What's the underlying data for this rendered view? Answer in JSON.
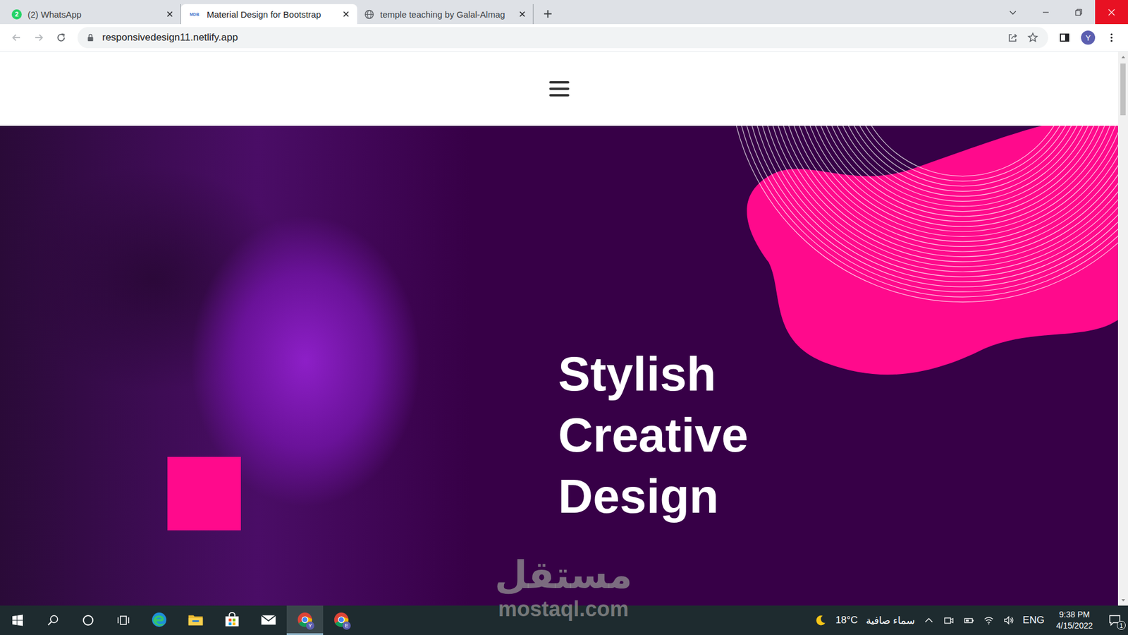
{
  "browser": {
    "tabs": [
      {
        "label": "(2) WhatsApp",
        "badge": "2",
        "kind": "whatsapp",
        "selected": false
      },
      {
        "label": "Material Design for Bootstrap",
        "badge": "MDB",
        "kind": "mdb",
        "selected": true
      },
      {
        "label": "temple teaching by Galal-Almag",
        "badge": "",
        "kind": "globe",
        "selected": false
      }
    ],
    "address": "responsivedesign11.netlify.app",
    "profile": "Y"
  },
  "page": {
    "hero": {
      "heading": [
        "Stylish",
        "Creative",
        "Design"
      ]
    }
  },
  "watermark": {
    "arabic": "مستقل",
    "latin": "mostaql.com"
  },
  "taskbar": {
    "apps": [
      {
        "kind": "edge",
        "badge": "",
        "active": false
      },
      {
        "kind": "explorer",
        "badge": "",
        "active": false
      },
      {
        "kind": "store",
        "badge": "",
        "active": false
      },
      {
        "kind": "mail",
        "badge": "",
        "active": false
      },
      {
        "kind": "chrome",
        "badge": "Y",
        "active": true
      },
      {
        "kind": "chrome",
        "badge": "E",
        "active": false
      }
    ],
    "weather": {
      "temp": "18°C",
      "condition": "سماء صافية"
    },
    "language": "ENG",
    "time": "9:38 PM",
    "date": "4/15/2022",
    "notifications": "1"
  }
}
